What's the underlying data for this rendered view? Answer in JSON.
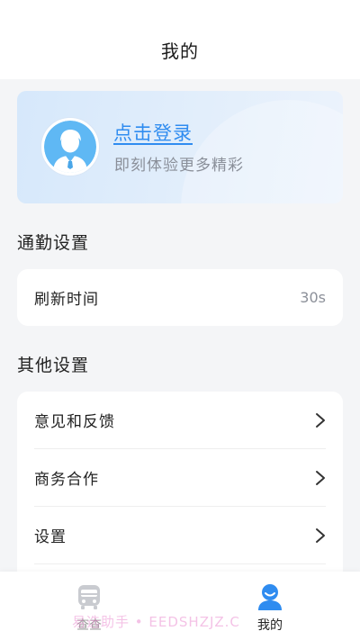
{
  "header": {
    "title": "我的"
  },
  "login": {
    "link_text": "点击登录",
    "subtitle": "即刻体验更多精彩",
    "avatar_icon": "user-avatar-icon"
  },
  "commute": {
    "section_title": "通勤设置",
    "rows": [
      {
        "label": "刷新时间",
        "value": "30s"
      }
    ]
  },
  "other": {
    "section_title": "其他设置",
    "rows": [
      {
        "label": "意见和反馈",
        "icon": "chevron-right-icon"
      },
      {
        "label": "商务合作",
        "icon": "chevron-right-icon"
      },
      {
        "label": "设置",
        "icon": "chevron-right-icon"
      }
    ]
  },
  "tabbar": {
    "tabs": [
      {
        "label": "查查",
        "icon": "bus-icon",
        "active": false
      },
      {
        "label": "我的",
        "icon": "profile-icon",
        "active": true
      }
    ]
  },
  "watermark": {
    "text": "易选助手 • EEDSHZJZ.C"
  },
  "colors": {
    "accent": "#2f8cf0",
    "page_bg": "#f4f5f7",
    "muted": "#8c9099"
  }
}
